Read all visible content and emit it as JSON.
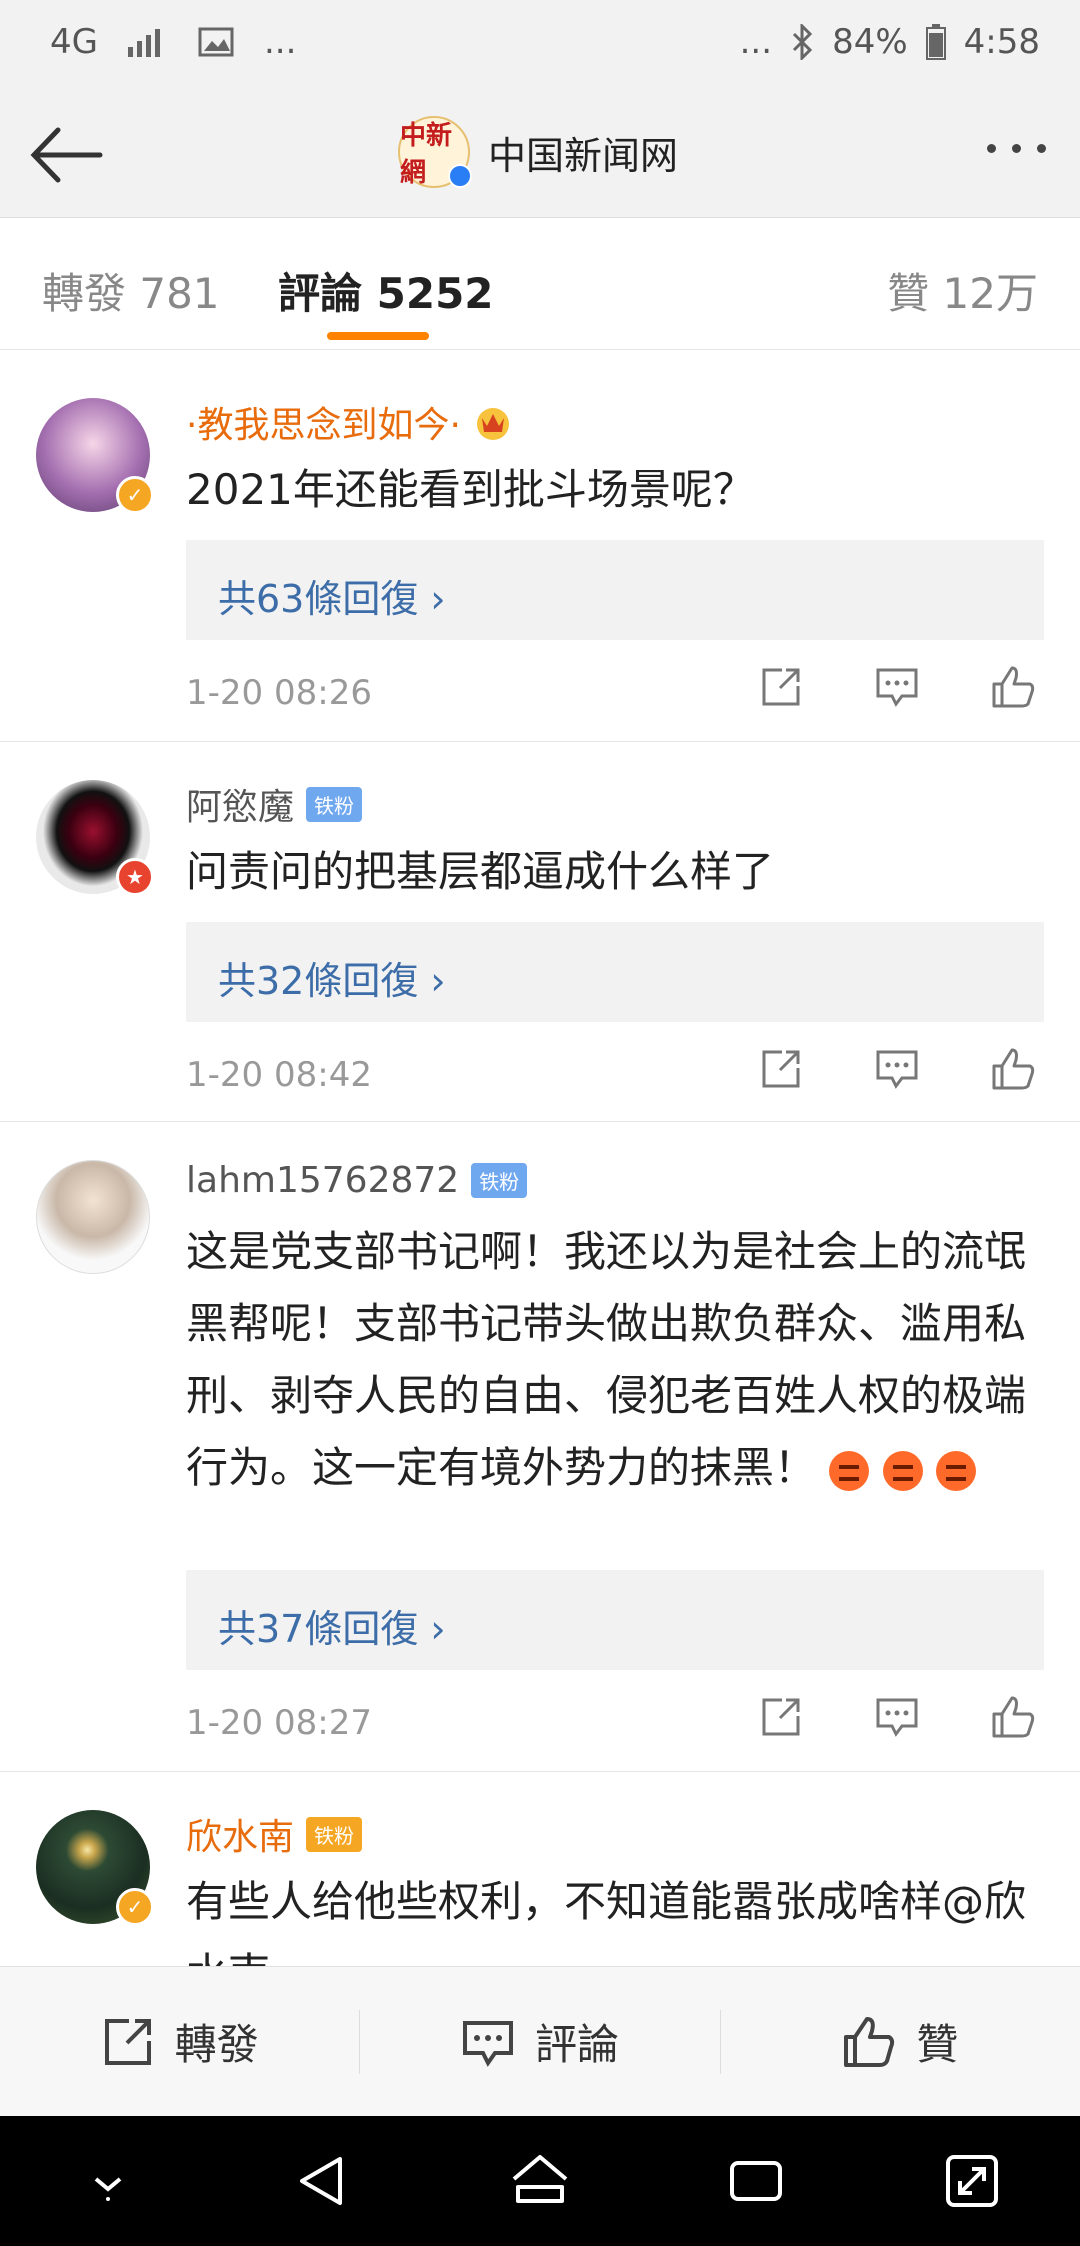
{
  "status_bar": {
    "network": "4G",
    "more": "...",
    "more_right": "...",
    "battery": "84%",
    "time": "4:58"
  },
  "header": {
    "title": "中国新闻网",
    "logo_text": "中新網"
  },
  "tabs": {
    "repost": "轉發 781",
    "comments": "評論 5252",
    "likes": "贊 12万"
  },
  "comments": [
    {
      "user": "·教我思念到如今·",
      "text": "2021年还能看到批斗场景呢？",
      "replies": "共63條回復 ›",
      "time": "1-20 08:26"
    },
    {
      "user": "阿慾魔",
      "badge": "铁粉",
      "text": "问责问的把基层都逼成什么样了",
      "replies": "共32條回復 ›",
      "time": "1-20 08:42"
    },
    {
      "user": "lahm15762872",
      "badge": "铁粉",
      "text": "这是党支部书记啊！我还以为是社会上的流氓黑帮呢！支部书记带头做出欺负群众、滥用私刑、剥夺人民的自由、侵犯老百姓人权的极端行为。这一定有境外势力的抹黑！",
      "replies": "共37條回復 ›",
      "time": "1-20 08:27"
    },
    {
      "user": "欣水南",
      "badge": "铁粉",
      "text": "有些人给他些权利，不知道能嚣张成啥样@欣水南"
    }
  ],
  "bottom_bar": {
    "repost": "轉發",
    "comment": "評論",
    "like": "贊"
  }
}
